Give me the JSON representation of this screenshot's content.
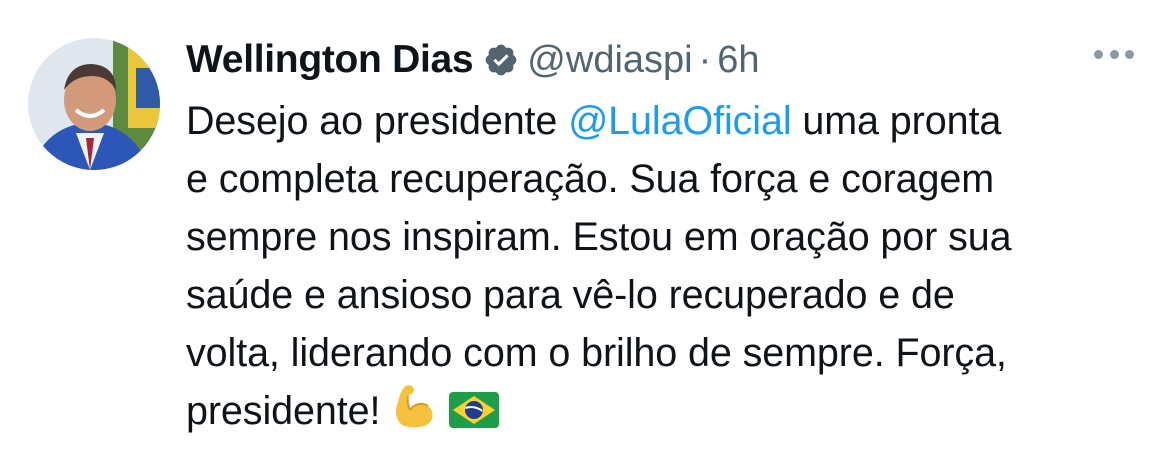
{
  "author": {
    "name": "Wellington Dias",
    "handle": "@wdiaspi",
    "separator": "·",
    "time": "6h",
    "avatar_icon": "profile-photo",
    "verified_icon": "verified-badge-icon"
  },
  "menu": {
    "icon": "more-horizontal-icon"
  },
  "tweet": {
    "line1_pre": "Desejo ao presidente ",
    "mention": "@LulaOficial",
    "line1_post": " uma pronta",
    "line2": "e completa recuperação. Sua força e coragem",
    "line3": "sempre nos inspiram. Estou em oração por sua",
    "line4": "saúde e ansioso para vê-lo recuperado e de",
    "line5": "volta, liderando com o brilho de sempre. Força,",
    "line6": "presidente!",
    "emojis": [
      "flexed-biceps-emoji",
      "brazil-flag-emoji"
    ]
  },
  "colors": {
    "text": "#0f1419",
    "secondary": "#536471",
    "link": "#1d9bf0",
    "badge": "#1d9bf0"
  }
}
